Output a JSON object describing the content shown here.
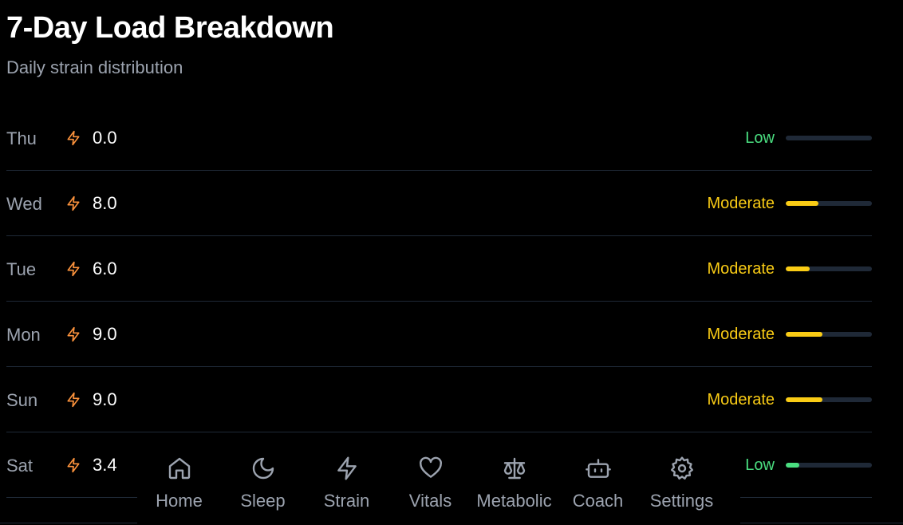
{
  "header": {
    "title": "7-Day Load Breakdown",
    "subtitle": "Daily strain distribution"
  },
  "colors": {
    "low": "#4ade80",
    "moderate": "#facc15",
    "bolt": "#fb923c",
    "track": "#1f2937"
  },
  "rows": [
    {
      "day": "Thu",
      "value": "0.0",
      "level": "Low",
      "level_color": "#4ade80",
      "fill_fraction": 0.0
    },
    {
      "day": "Wed",
      "value": "8.0",
      "level": "Moderate",
      "level_color": "#facc15",
      "fill_fraction": 0.38
    },
    {
      "day": "Tue",
      "value": "6.0",
      "level": "Moderate",
      "level_color": "#facc15",
      "fill_fraction": 0.28
    },
    {
      "day": "Mon",
      "value": "9.0",
      "level": "Moderate",
      "level_color": "#facc15",
      "fill_fraction": 0.43
    },
    {
      "day": "Sun",
      "value": "9.0",
      "level": "Moderate",
      "level_color": "#facc15",
      "fill_fraction": 0.43
    },
    {
      "day": "Sat",
      "value": "3.4",
      "level": "Low",
      "level_color": "#4ade80",
      "fill_fraction": 0.16
    }
  ],
  "nav": {
    "items": [
      {
        "label": "Home",
        "icon": "home-icon"
      },
      {
        "label": "Sleep",
        "icon": "moon-icon"
      },
      {
        "label": "Strain",
        "icon": "bolt-icon"
      },
      {
        "label": "Vitals",
        "icon": "heart-icon"
      },
      {
        "label": "Metabolic",
        "icon": "scale-icon"
      },
      {
        "label": "Coach",
        "icon": "bot-icon"
      },
      {
        "label": "Settings",
        "icon": "gear-icon"
      }
    ]
  }
}
